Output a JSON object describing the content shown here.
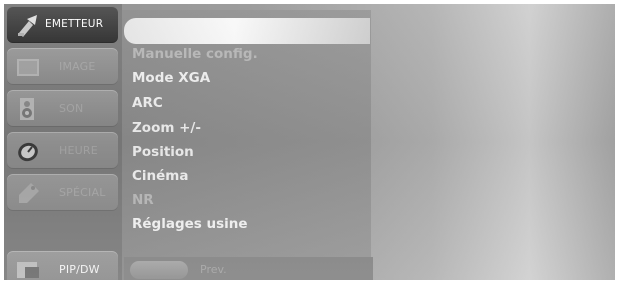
{
  "sidebar": {
    "items": [
      {
        "label": "EMETTEUR",
        "icon": "antenna-icon",
        "active": true
      },
      {
        "label": "IMAGE",
        "icon": "picture-icon",
        "active": false
      },
      {
        "label": "SON",
        "icon": "speaker-icon",
        "active": false
      },
      {
        "label": "HEURE",
        "icon": "clock-icon",
        "active": false
      },
      {
        "label": "SPÉCIAL",
        "icon": "tag-icon",
        "active": false
      },
      {
        "label": "PIP/DW",
        "icon": "pip-icon",
        "active": false
      }
    ]
  },
  "menu": {
    "items": [
      {
        "label": "Manuelle config."
      },
      {
        "label": "Mode XGA"
      },
      {
        "label": "ARC"
      },
      {
        "label": "Zoom +/-"
      },
      {
        "label": "Position"
      },
      {
        "label": "Cinéma"
      },
      {
        "label": "NR"
      },
      {
        "label": "Réglages usine"
      }
    ],
    "prev_label": "Prev."
  },
  "colors": {
    "active_item": "#3a3a3a",
    "menu_text": "#f2f2f2",
    "screen_bg": "#989898"
  }
}
